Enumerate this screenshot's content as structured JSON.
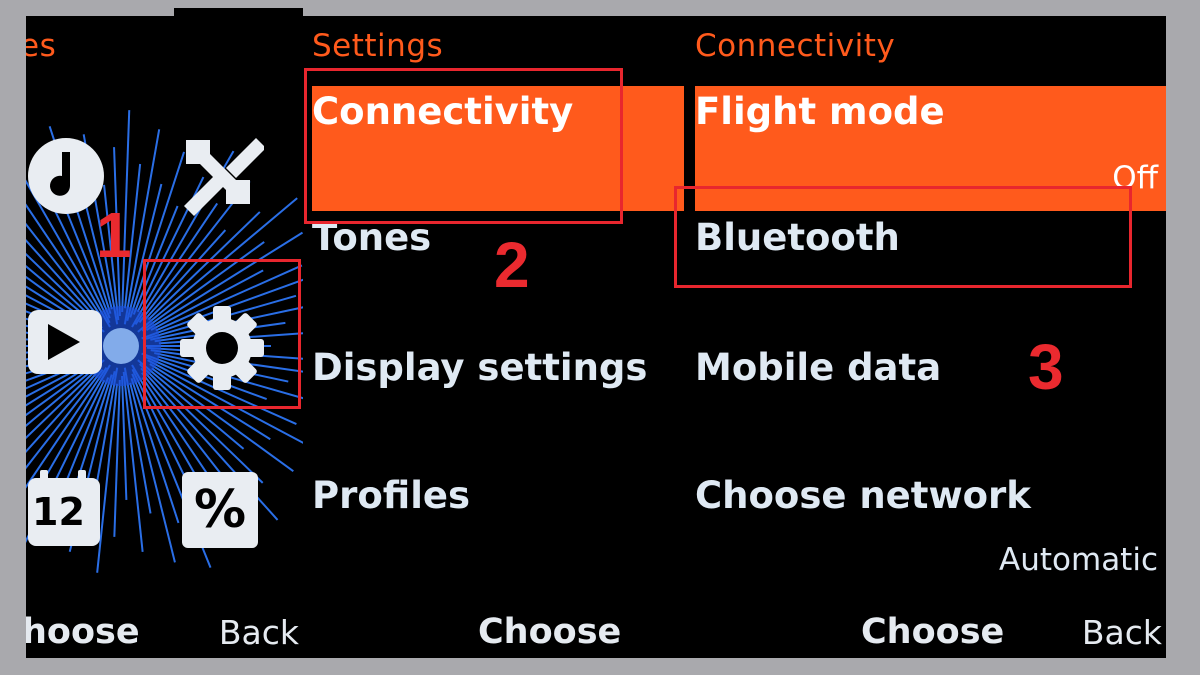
{
  "colors": {
    "accent": "#ff5a1c",
    "annotation": "#ea2a2f",
    "background": "#000000",
    "frame": "#a9a9ad"
  },
  "screen1": {
    "header": "es",
    "apps": [
      {
        "icon": "music-icon"
      },
      {
        "icon": "tools-icon"
      },
      {
        "icon": "video-icon"
      },
      {
        "icon": "settings-gear-icon"
      },
      {
        "icon": "calendar-icon",
        "label": "12"
      },
      {
        "icon": "calculator-icon",
        "label": "%"
      }
    ],
    "softkeys": {
      "left": "hoose",
      "right": "Back"
    }
  },
  "screen2": {
    "header": "Settings",
    "items": [
      "Connectivity",
      "Tones",
      "Display settings",
      "Profiles"
    ],
    "selected_index": 0,
    "softkeys": {
      "center": "Choose"
    }
  },
  "screen3": {
    "header": "Connectivity",
    "items": [
      {
        "label": "Flight mode",
        "value": "Off"
      },
      {
        "label": "Bluetooth"
      },
      {
        "label": "Mobile data"
      },
      {
        "label": "Choose network",
        "value": "Automatic"
      }
    ],
    "selected_index": 0,
    "softkeys": {
      "center": "Choose",
      "right": "Back"
    }
  },
  "annotations": {
    "step1": "1",
    "step2": "2",
    "step3": "3"
  }
}
